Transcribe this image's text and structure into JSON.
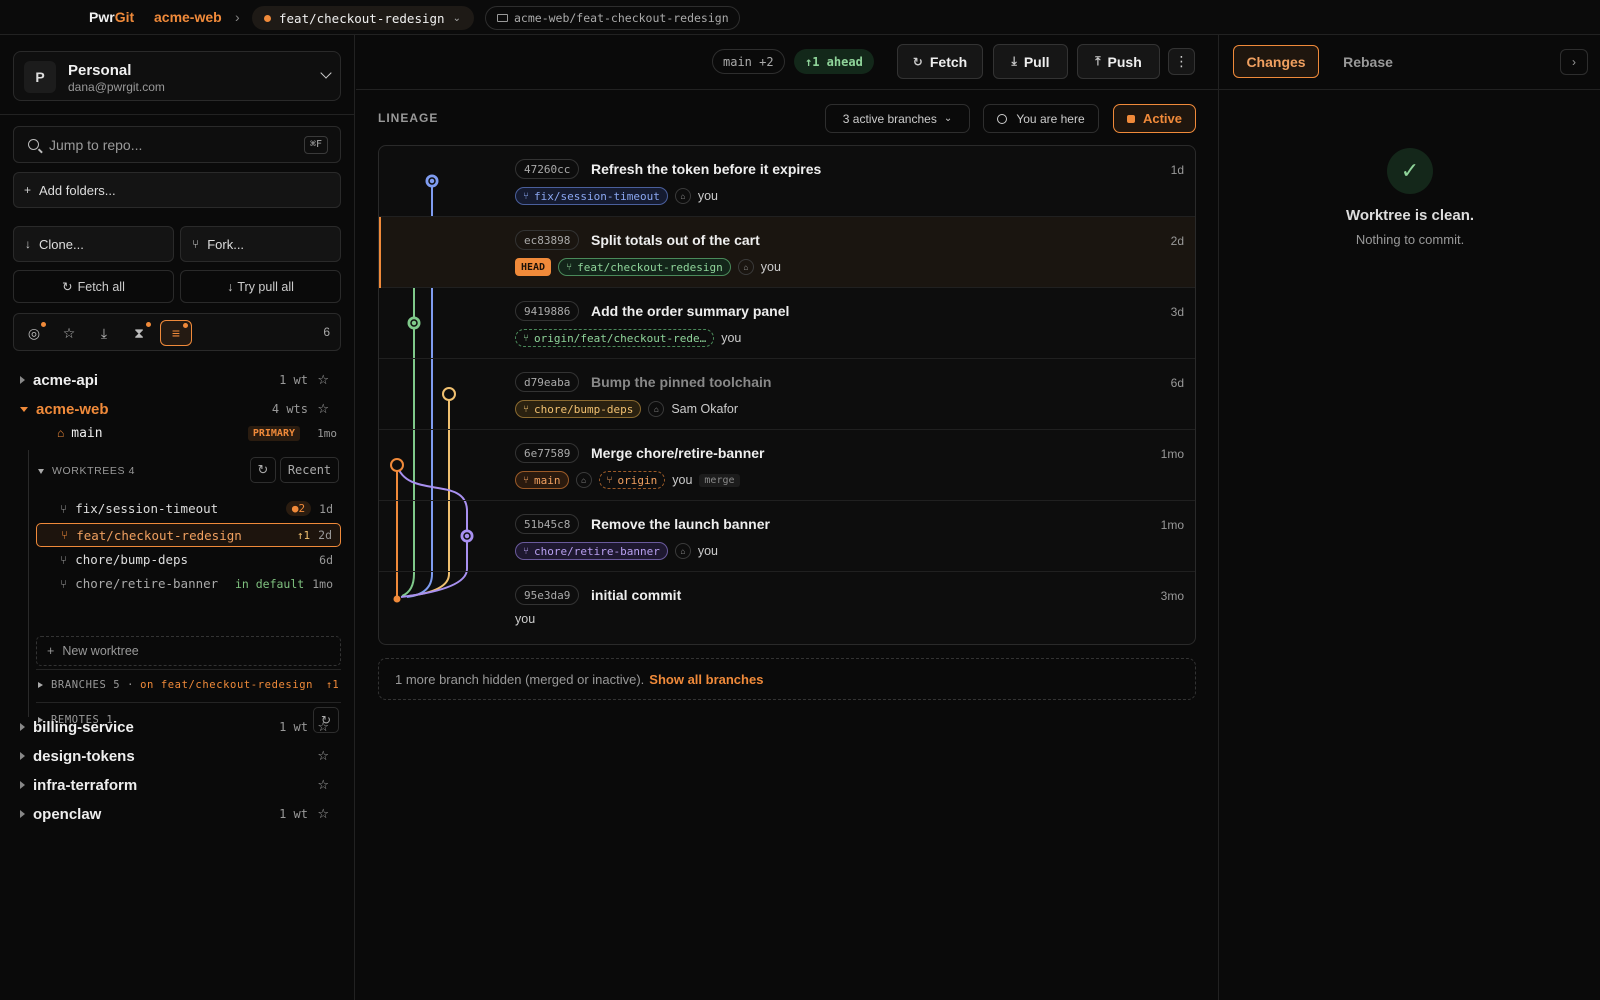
{
  "topbar": {
    "brand_a": "Pwr",
    "brand_b": "Git",
    "repo": "acme-web",
    "sep": "›",
    "branch": "feat/checkout-redesign",
    "path": "acme-web/feat-checkout-redesign"
  },
  "account": {
    "initial": "P",
    "name": "Personal",
    "email": "dana@pwrgit.com"
  },
  "search": {
    "placeholder": "Jump to repo...",
    "shortcut": "⌘F"
  },
  "actions": {
    "add_folders": "Add folders...",
    "clone": "Clone...",
    "fork": "Fork...",
    "fetch_all": "Fetch all",
    "try_pull_all": "Try pull all"
  },
  "filters": {
    "count": "6"
  },
  "repos": [
    {
      "name": "acme-api",
      "wts": "1 wt"
    },
    {
      "name": "acme-web",
      "wts": "4 wts"
    },
    {
      "name": "billing-service",
      "wts": "1 wt"
    },
    {
      "name": "design-tokens",
      "wts": ""
    },
    {
      "name": "infra-terraform",
      "wts": ""
    },
    {
      "name": "openclaw",
      "wts": "1 wt"
    }
  ],
  "acme_web": {
    "main": {
      "label": "main",
      "tag": "PRIMARY",
      "age": "1mo"
    },
    "worktrees_label": "WORKTREES 4",
    "recent": "Recent",
    "worktrees": [
      {
        "name": "fix/session-timeout",
        "badge": "●2",
        "age": "1d"
      },
      {
        "name": "feat/checkout-redesign",
        "badge": "↑1",
        "age": "2d"
      },
      {
        "name": "chore/bump-deps",
        "badge": "",
        "age": "6d"
      },
      {
        "name": "chore/retire-banner",
        "badge": "in default",
        "age": "1mo"
      }
    ],
    "new_worktree": "New worktree",
    "branches_label": "BRANCHES 5 ·",
    "branches_on": "on feat/checkout-redesign",
    "branches_ahead": "↑1",
    "remotes_label": "REMOTES 1"
  },
  "toolbar": {
    "main_chip": "main +2",
    "ahead": "↑1 ahead",
    "fetch": "Fetch",
    "pull": "Pull",
    "push": "Push"
  },
  "lineage": {
    "label": "LINEAGE",
    "active_branches": "3 active branches",
    "you_are_here": "You are here",
    "active": "Active",
    "hidden_note": "1 more branch hidden (merged or inactive).",
    "show_all": "Show all branches"
  },
  "commits": [
    {
      "sha": "47260cc",
      "msg": "Refresh the token before it expires",
      "age": "1d",
      "tags": [
        "fix/session-timeout"
      ],
      "author": "you"
    },
    {
      "sha": "ec83898",
      "msg": "Split totals out of the cart",
      "age": "2d",
      "head": "HEAD",
      "tags": [
        "feat/checkout-redesign"
      ],
      "author": "you"
    },
    {
      "sha": "9419886",
      "msg": "Add the order summary panel",
      "age": "3d",
      "tags": [
        "origin/feat/checkout-rede…"
      ],
      "author": "you"
    },
    {
      "sha": "d79eaba",
      "msg": "Bump the pinned toolchain",
      "age": "6d",
      "tags": [
        "chore/bump-deps"
      ],
      "author": "Sam Okafor"
    },
    {
      "sha": "6e77589",
      "msg": "Merge chore/retire-banner",
      "age": "1mo",
      "tags": [
        "main",
        "origin"
      ],
      "author": "you",
      "extra": "merge"
    },
    {
      "sha": "51b45c8",
      "msg": "Remove the launch banner",
      "age": "1mo",
      "tags": [
        "chore/retire-banner"
      ],
      "author": "you"
    },
    {
      "sha": "95e3da9",
      "msg": "initial commit",
      "age": "3mo",
      "tags": [],
      "author": "you"
    }
  ],
  "graph_colors": {
    "blue": "#7f9cf0",
    "green": "#7fc98a",
    "yellow": "#f0c070",
    "orange": "#f08a3a",
    "purple": "#a890f0"
  },
  "right": {
    "tab_changes": "Changes",
    "tab_rebase": "Rebase",
    "clean_title": "Worktree is clean.",
    "clean_sub": "Nothing to commit."
  }
}
